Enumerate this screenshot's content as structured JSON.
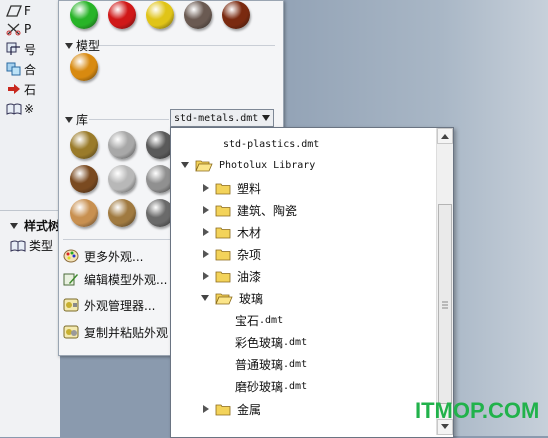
{
  "sidebar": {
    "items": [
      {
        "label": "F",
        "icon": "parallelogram-icon"
      },
      {
        "label": "P",
        "icon": "scissors-icon"
      },
      {
        "label": "号",
        "icon": "axis-icon"
      },
      {
        "label": "合",
        "icon": "merge-icon"
      },
      {
        "label": "石",
        "icon": "red-arrow-icon"
      },
      {
        "label": "※",
        "icon": "book-icon"
      }
    ],
    "style_panel": {
      "title": "样式树",
      "item_label": "类型"
    }
  },
  "flyout": {
    "top_swatches": [
      "#28b428",
      "#d01818",
      "#e0c418",
      "#6a5a52",
      "#7a2a10"
    ],
    "model_section": {
      "title": "模型",
      "swatches": [
        "#d88a10"
      ]
    },
    "library_section": {
      "title": "库",
      "selected_library": "std-metals.dmt",
      "swatches": [
        "#9a7b2a",
        "#a8a8a8",
        "#5a5a5a",
        "#7a4a20",
        "#b8b8b8",
        "#909090",
        "#c89050",
        "#a07a40",
        "#6a6a6a"
      ]
    },
    "menu_items": [
      {
        "label": "更多外观...",
        "icon": "palette-icon"
      },
      {
        "label": "编辑模型外观...",
        "icon": "edit-appearance-icon"
      },
      {
        "label": "外观管理器...",
        "icon": "appearance-manager-icon"
      },
      {
        "label": "复制并粘贴外观",
        "icon": "copy-paste-appearance-icon"
      }
    ]
  },
  "dropdown": {
    "items": [
      {
        "label": "std-plastics.dmt",
        "type": "file",
        "level": 0
      },
      {
        "label": "Photolux Library",
        "type": "folder-open",
        "level": 0
      },
      {
        "label": "塑料",
        "type": "folder",
        "level": 1
      },
      {
        "label": "建筑、陶瓷",
        "type": "folder",
        "level": 1
      },
      {
        "label": "木材",
        "type": "folder",
        "level": 1
      },
      {
        "label": "杂项",
        "type": "folder",
        "level": 1
      },
      {
        "label": "油漆",
        "type": "folder",
        "level": 1
      },
      {
        "label": "玻璃",
        "type": "folder-open",
        "level": 1
      },
      {
        "label_main": "宝石",
        "label_ext": ".dmt",
        "type": "file",
        "level": 2
      },
      {
        "label_main": "彩色玻璃",
        "label_ext": ".dmt",
        "type": "file",
        "level": 2
      },
      {
        "label_main": "普通玻璃",
        "label_ext": ".dmt",
        "type": "file",
        "level": 2
      },
      {
        "label_main": "磨砂玻璃",
        "label_ext": ".dmt",
        "type": "file",
        "level": 2
      },
      {
        "label": "金属",
        "type": "folder",
        "level": 1
      }
    ]
  },
  "watermark": "ITMOP.COM",
  "colors": {
    "folder_yellow": "#f3d35a",
    "watermark_green": "#21b24b"
  }
}
